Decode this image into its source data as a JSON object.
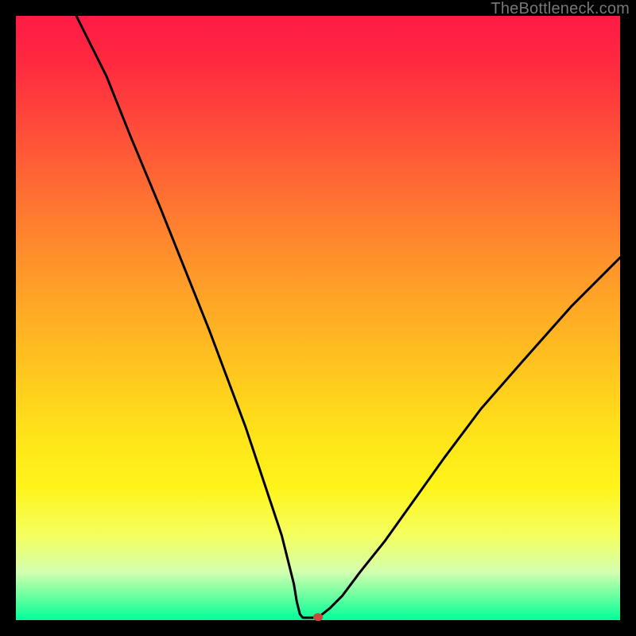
{
  "watermark": "TheBottleneck.com",
  "chart_data": {
    "type": "line",
    "title": "",
    "xlabel": "",
    "ylabel": "",
    "xlim": [
      0,
      100
    ],
    "ylim": [
      0,
      100
    ],
    "grid": false,
    "legend": false,
    "curve_points_xy_percent": [
      [
        10,
        100
      ],
      [
        15,
        90
      ],
      [
        19,
        80
      ],
      [
        24,
        68
      ],
      [
        28,
        58
      ],
      [
        32,
        48
      ],
      [
        35,
        40
      ],
      [
        38,
        32
      ],
      [
        40,
        26
      ],
      [
        42,
        20
      ],
      [
        44,
        14
      ],
      [
        45,
        10
      ],
      [
        46,
        6
      ],
      [
        46.5,
        3
      ],
      [
        47,
        1
      ],
      [
        47.5,
        0.4
      ],
      [
        50,
        0.4
      ],
      [
        50.5,
        0.8
      ],
      [
        52,
        2
      ],
      [
        54,
        4
      ],
      [
        57,
        8
      ],
      [
        61,
        13
      ],
      [
        66,
        20
      ],
      [
        71,
        27
      ],
      [
        77,
        35
      ],
      [
        84,
        43
      ],
      [
        92,
        52
      ],
      [
        100,
        60
      ]
    ],
    "marker": {
      "x_percent": 50,
      "y_percent": 0.5,
      "color": "#c84a3a"
    },
    "background_gradient": {
      "direction": "vertical",
      "stops": [
        {
          "pos": 0,
          "color": "#ff1a46"
        },
        {
          "pos": 50,
          "color": "#ffa826"
        },
        {
          "pos": 80,
          "color": "#fff41a"
        },
        {
          "pos": 100,
          "color": "#00ff98"
        }
      ]
    }
  }
}
